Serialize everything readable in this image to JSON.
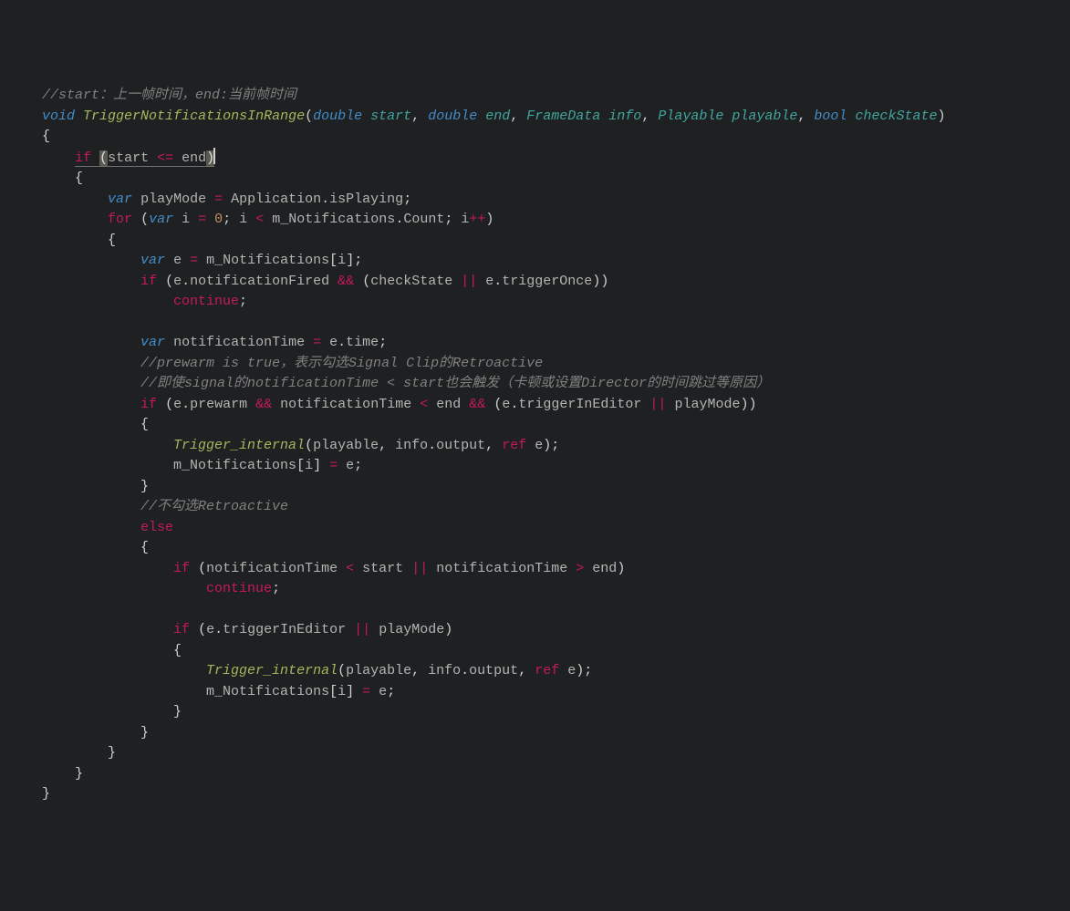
{
  "code": {
    "c1": "//start：上一帧时间，end:当前帧时间",
    "kw_void": "void",
    "fn_name": "TriggerNotificationsInRange",
    "ty_double1": "double",
    "p_start": "start",
    "ty_double2": "double",
    "p_end": "end",
    "ty_FrameData": "FrameData",
    "p_info": "info",
    "ty_Playable": "Playable",
    "p_playable": "playable",
    "ty_bool": "bool",
    "p_checkState": "checkState",
    "ob1": "{",
    "kw_if1": "if",
    "lp1": "(",
    "v_start1": "start",
    "op_le": "<=",
    "v_end1": "end",
    "rp1": ")",
    "ob2": "{",
    "kw_var1": "var",
    "v_playMode": "playMode",
    "op_eq1": "=",
    "v_App": "Application",
    "dot1": ".",
    "v_isPlaying": "isPlaying",
    "sc1": ";",
    "kw_for": "for",
    "lp_for": "(",
    "kw_var2": "var",
    "v_i1": "i",
    "op_eq2": "=",
    "n_zero": "0",
    "sc2": ";",
    "v_i2": "i",
    "op_lt": "<",
    "v_mNotif1": "m_Notifications",
    "dot2": ".",
    "v_Count": "Count",
    "sc3": ";",
    "v_i3": "i",
    "op_pp": "++",
    "rp_for": ")",
    "ob3": "{",
    "kw_var3": "var",
    "v_e1": "e",
    "op_eq3": "=",
    "v_mNotif2": "m_Notifications",
    "lb1": "[",
    "v_i4": "i",
    "rb1": "]",
    "sc4": ";",
    "kw_if2": "if",
    "lp2": "(",
    "v_e2": "e",
    "dot3": ".",
    "v_notifFired": "notificationFired",
    "op_and1": "&&",
    "lp3": "(",
    "v_checkState2": "checkState",
    "op_or1": "||",
    "v_e3": "e",
    "dot4": ".",
    "v_trigOnce": "triggerOnce",
    "rp3": ")",
    "rp2": ")",
    "kw_continue1": "continue",
    "sc5": ";",
    "kw_var4": "var",
    "v_notifTime1": "notificationTime",
    "op_eq4": "=",
    "v_e4": "e",
    "dot5": ".",
    "v_time": "time",
    "sc6": ";",
    "c2": "//prewarm is true，表示勾选Signal Clip的Retroactive",
    "c3": "//即使signal的notificationTime < start也会触发（卡顿或设置Director的时间跳过等原因）",
    "kw_if3": "if",
    "lp4": "(",
    "v_e5": "e",
    "dot6": ".",
    "v_prewarm": "prewarm",
    "op_and2": "&&",
    "v_notifTime2": "notificationTime",
    "op_lt2": "<",
    "v_end2": "end",
    "op_and3": "&&",
    "lp5": "(",
    "v_e6": "e",
    "dot7": ".",
    "v_trigEd1": "triggerInEditor",
    "op_or2": "||",
    "v_playMode2": "playMode",
    "rp5": ")",
    "rp4": ")",
    "ob4": "{",
    "fn_TrigInt1": "Trigger_internal",
    "lp6": "(",
    "v_playable1": "playable",
    "com1": ",",
    "v_info1": "info",
    "dot8": ".",
    "v_output1": "output",
    "com2": ",",
    "kw_ref1": "ref",
    "v_e7": "e",
    "rp6": ")",
    "sc7": ";",
    "v_mNotif3": "m_Notifications",
    "lb2": "[",
    "v_i5": "i",
    "rb2": "]",
    "op_eq5": "=",
    "v_e8": "e",
    "sc8": ";",
    "cb4": "}",
    "c4": "//不勾选Retroactive",
    "kw_else": "else",
    "ob5": "{",
    "kw_if4": "if",
    "lp7": "(",
    "v_notifTime3": "notificationTime",
    "op_lt3": "<",
    "v_start2": "start",
    "op_or3": "||",
    "v_notifTime4": "notificationTime",
    "op_gt": ">",
    "v_end3": "end",
    "rp7": ")",
    "kw_continue2": "continue",
    "sc9": ";",
    "kw_if5": "if",
    "lp8": "(",
    "v_e9": "e",
    "dot9": ".",
    "v_trigEd2": "triggerInEditor",
    "op_or4": "||",
    "v_playMode3": "playMode",
    "rp8": ")",
    "ob6": "{",
    "fn_TrigInt2": "Trigger_internal",
    "lp9": "(",
    "v_playable2": "playable",
    "com3": ",",
    "v_info2": "info",
    "dot10": ".",
    "v_output2": "output",
    "com4": ",",
    "kw_ref2": "ref",
    "v_e10": "e",
    "rp9": ")",
    "sc10": ";",
    "v_mNotif4": "m_Notifications",
    "lb3": "[",
    "v_i6": "i",
    "rb3": "]",
    "op_eq6": "=",
    "v_e11": "e",
    "sc11": ";",
    "cb6": "}",
    "cb5": "}",
    "cb3": "}",
    "cb2": "}",
    "cb1": "}",
    "sp4": "    ",
    "sp8": "        ",
    "sp12": "            ",
    "sp16": "                ",
    "sp20": "                    ",
    "sp24": "                        "
  }
}
